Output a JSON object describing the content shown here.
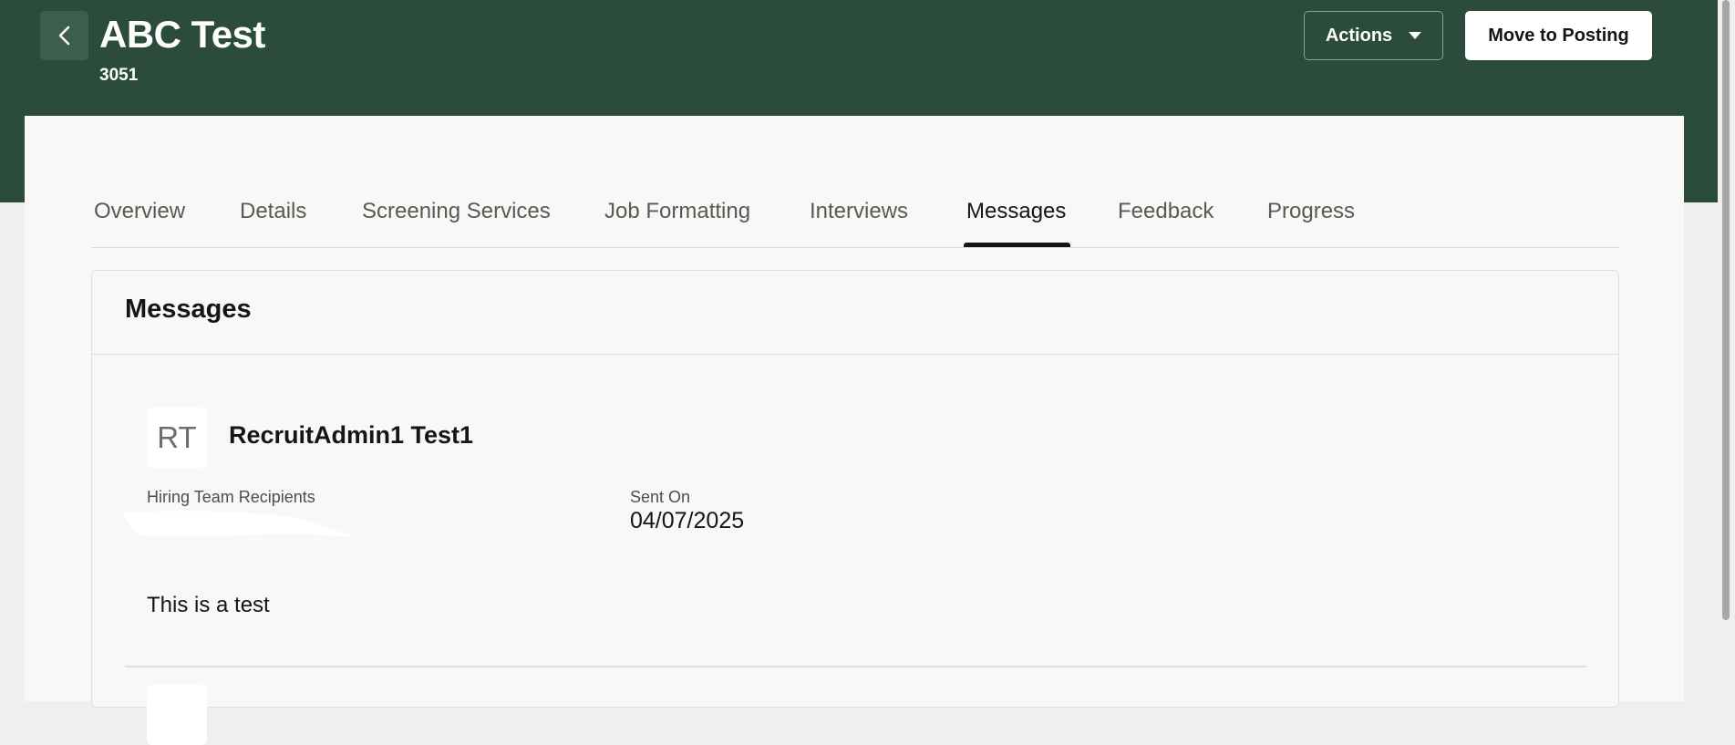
{
  "header": {
    "title": "ABC Test",
    "subtitle": "3051",
    "back_icon": "chevron-left-icon",
    "actions_label": "Actions",
    "move_label": "Move to Posting",
    "brand_color": "#2c4c3b"
  },
  "tabs": [
    {
      "label": "Overview"
    },
    {
      "label": "Details"
    },
    {
      "label": "Screening Services"
    },
    {
      "label": "Job Formatting"
    },
    {
      "label": "Interviews"
    },
    {
      "label": "Messages",
      "active": true
    },
    {
      "label": "Feedback"
    },
    {
      "label": "Progress"
    }
  ],
  "messages": {
    "title": "Messages",
    "items": [
      {
        "initials": "RT",
        "sender": "RecruitAdmin1 Test1",
        "recipients_label": "Hiring Team Recipients",
        "sent_on_label": "Sent On",
        "sent_on": "04/07/2025",
        "body": "This is a test"
      }
    ]
  }
}
